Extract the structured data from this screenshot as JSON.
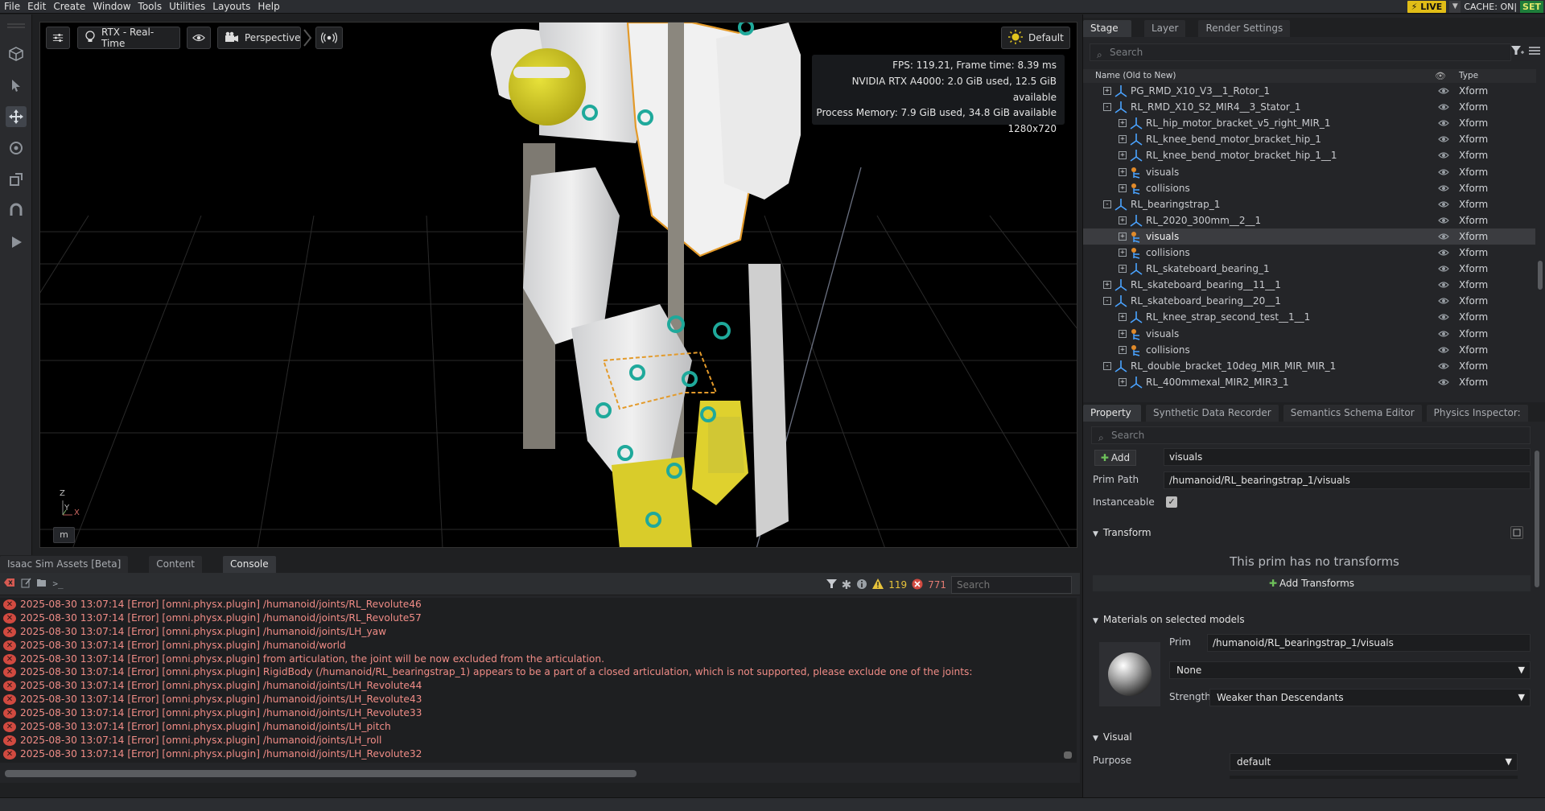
{
  "menu": [
    "File",
    "Edit",
    "Create",
    "Window",
    "Tools",
    "Utilities",
    "Layouts",
    "Help"
  ],
  "status": {
    "live": "LIVE",
    "cache": "CACHE: ON|",
    "set": "SET"
  },
  "viewport": {
    "render_mode": "RTX - Real-Time",
    "camera": "Perspective",
    "lighting": "Default",
    "stats": [
      "FPS: 119.21, Frame time: 8.39 ms",
      "NVIDIA RTX A4000: 2.0 GiB used, 12.5 GiB available",
      "Process Memory: 7.9 GiB used, 34.8 GiB available",
      "1280x720"
    ],
    "axis_z": "Z",
    "axis_y": "Y",
    "axis_x": "X",
    "units_button": "m"
  },
  "bottom_tabs": [
    "Isaac Sim Assets [Beta]",
    "Content",
    "Console"
  ],
  "console": {
    "warnings": "119",
    "errors": "771",
    "search_placeholder": "Search",
    "lines": [
      "2025-08-30 13:07:14  [Error] [omni.physx.plugin] /humanoid/joints/RL_Revolute46",
      "2025-08-30 13:07:14  [Error] [omni.physx.plugin] /humanoid/joints/RL_Revolute57",
      "2025-08-30 13:07:14  [Error] [omni.physx.plugin] /humanoid/joints/LH_yaw",
      "2025-08-30 13:07:14  [Error] [omni.physx.plugin] /humanoid/world",
      "2025-08-30 13:07:14  [Error] [omni.physx.plugin]  from articulation, the joint will be now excluded from the articulation.",
      "2025-08-30 13:07:14  [Error] [omni.physx.plugin] RigidBody (/humanoid/RL_bearingstrap_1) appears to be a part of a closed articulation, which is not supported, please exclude one of the joints:",
      "2025-08-30 13:07:14  [Error] [omni.physx.plugin] /humanoid/joints/LH_Revolute44",
      "2025-08-30 13:07:14  [Error] [omni.physx.plugin] /humanoid/joints/LH_Revolute43",
      "2025-08-30 13:07:14  [Error] [omni.physx.plugin] /humanoid/joints/LH_Revolute33",
      "2025-08-30 13:07:14  [Error] [omni.physx.plugin] /humanoid/joints/LH_pitch",
      "2025-08-30 13:07:14  [Error] [omni.physx.plugin] /humanoid/joints/LH_roll",
      "2025-08-30 13:07:14  [Error] [omni.physx.plugin] /humanoid/joints/LH_Revolute32"
    ]
  },
  "stage": {
    "tabs": [
      "Stage",
      "Layer",
      "Render Settings"
    ],
    "search_placeholder": "Search",
    "col_name": "Name (Old to New)",
    "col_type": "Type",
    "rows": [
      {
        "name": "PG_RMD_X10_V3__1_Rotor_1",
        "type": "Xform",
        "depth": 1,
        "exp": "+",
        "icon": "xform"
      },
      {
        "name": "RL_RMD_X10_S2_MIR4__3_Stator_1",
        "type": "Xform",
        "depth": 1,
        "exp": "-",
        "icon": "xform"
      },
      {
        "name": "RL_hip_motor_bracket_v5_right_MIR_1",
        "type": "Xform",
        "depth": 2,
        "exp": "+",
        "icon": "xform"
      },
      {
        "name": "RL_knee_bend_motor_bracket_hip_1",
        "type": "Xform",
        "depth": 2,
        "exp": "+",
        "icon": "xform"
      },
      {
        "name": "RL_knee_bend_motor_bracket_hip_1__1",
        "type": "Xform",
        "depth": 2,
        "exp": "+",
        "icon": "xform"
      },
      {
        "name": "visuals",
        "type": "Xform",
        "depth": 2,
        "exp": "+",
        "icon": "geom"
      },
      {
        "name": "collisions",
        "type": "Xform",
        "depth": 2,
        "exp": "+",
        "icon": "geom"
      },
      {
        "name": "RL_bearingstrap_1",
        "type": "Xform",
        "depth": 1,
        "exp": "-",
        "icon": "xform"
      },
      {
        "name": "RL_2020_300mm__2__1",
        "type": "Xform",
        "depth": 2,
        "exp": "+",
        "icon": "xform"
      },
      {
        "name": "visuals",
        "type": "Xform",
        "depth": 2,
        "exp": "+",
        "icon": "geom",
        "selected": true
      },
      {
        "name": "collisions",
        "type": "Xform",
        "depth": 2,
        "exp": "+",
        "icon": "geom"
      },
      {
        "name": "RL_skateboard_bearing_1",
        "type": "Xform",
        "depth": 2,
        "exp": "+",
        "icon": "xform"
      },
      {
        "name": "RL_skateboard_bearing__11__1",
        "type": "Xform",
        "depth": 1,
        "exp": "+",
        "icon": "xform"
      },
      {
        "name": "RL_skateboard_bearing__20__1",
        "type": "Xform",
        "depth": 1,
        "exp": "-",
        "icon": "xform"
      },
      {
        "name": "RL_knee_strap_second_test__1__1",
        "type": "Xform",
        "depth": 2,
        "exp": "+",
        "icon": "xform"
      },
      {
        "name": "visuals",
        "type": "Xform",
        "depth": 2,
        "exp": "+",
        "icon": "geom"
      },
      {
        "name": "collisions",
        "type": "Xform",
        "depth": 2,
        "exp": "+",
        "icon": "geom"
      },
      {
        "name": "RL_double_bracket_10deg_MIR_MIR_MIR_1",
        "type": "Xform",
        "depth": 1,
        "exp": "-",
        "icon": "xform"
      },
      {
        "name": "RL_400mmexal_MIR2_MIR3_1",
        "type": "Xform",
        "depth": 2,
        "exp": "+",
        "icon": "xform"
      }
    ]
  },
  "property": {
    "tabs": [
      "Property",
      "Synthetic Data Recorder",
      "Semantics Schema Editor",
      "Physics Inspector:"
    ],
    "search_placeholder": "Search",
    "add_label": "Add",
    "prim_name": "visuals",
    "prim_path_label": "Prim Path",
    "prim_path": "/humanoid/RL_bearingstrap_1/visuals",
    "instanceable_label": "Instanceable",
    "transform_section": "Transform",
    "no_transforms": "This prim has no transforms",
    "add_transforms": "Add Transforms",
    "materials_section": "Materials on selected models",
    "prim_label": "Prim",
    "material_prim": "/humanoid/RL_bearingstrap_1/visuals",
    "material_value": "None",
    "strength_label": "Strength",
    "strength_value": "Weaker than Descendants",
    "visual_section": "Visual",
    "purpose_label": "Purpose",
    "purpose_value": "default"
  }
}
